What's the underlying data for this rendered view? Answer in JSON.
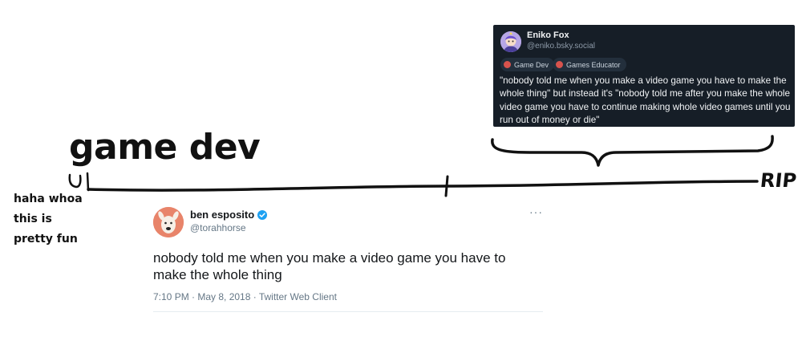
{
  "caption": {
    "title": "game dev",
    "note": [
      "haha whoa",
      "this is",
      "pretty fun"
    ],
    "end_label": "RIP"
  },
  "bluesky_post": {
    "author_name": "Eniko Fox",
    "author_handle": "@eniko.bsky.social",
    "tags": [
      "Game Dev",
      "Games Educator"
    ],
    "text": "\"nobody told me when you make a video game you have to make the whole thing\" but instead it's \"nobody told me after you make the whole video game you have to continue making whole video games until you run out of money or die\"",
    "colors": {
      "background": "#161e27",
      "text": "#f1f3f5",
      "tag_background": "#232f3c"
    }
  },
  "tweet": {
    "author_name": "ben esposito",
    "author_handle": "@torahhorse",
    "text": "nobody told me when you make a video game you have to make the whole thing",
    "meta": "7:10 PM · May 8, 2018 · Twitter Web Client",
    "more_icon": "···",
    "verified_icon": "verified-badge-icon",
    "colors": {
      "verified": "#1da1f2",
      "avatar": "#e8846a"
    }
  }
}
